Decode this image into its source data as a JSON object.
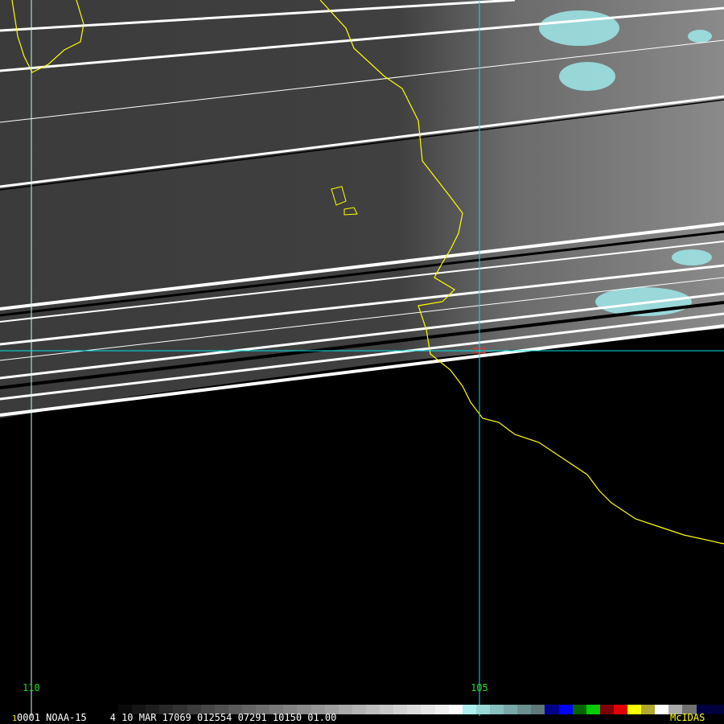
{
  "image": {
    "frame_number": "1",
    "header_text": "0001 NOAA-15    4 10 MAR 17069 012554 07291 10150 01.00",
    "brand": "McIDAS",
    "satellite": "NOAA-15"
  },
  "grid": {
    "longitude_labels": [
      "110",
      "105"
    ]
  },
  "colors": {
    "coastline": "#ffff00",
    "grid_line": "#00e5ee",
    "grid_label": "#22dd22",
    "cloud_tint": "#9fe8ea"
  },
  "colorbar": [
    "#0a0a0a",
    "#141414",
    "#1e1e1e",
    "#282828",
    "#323232",
    "#3c3c3c",
    "#464646",
    "#505050",
    "#5a5a5a",
    "#646464",
    "#6e6e6e",
    "#787878",
    "#828282",
    "#8c8c8c",
    "#969696",
    "#a0a0a0",
    "#aaaaaa",
    "#b4b4b4",
    "#bebebe",
    "#c8c8c8",
    "#d2d2d2",
    "#dcdcdc",
    "#e6e6e6",
    "#f0f0f0",
    "#ffffff",
    "#aeeeee",
    "#9ad8d8",
    "#88c0c0",
    "#78a8a8",
    "#6a9090",
    "#5f7878",
    "#00008b",
    "#0000ff",
    "#006400",
    "#00cc00",
    "#800000",
    "#e00000",
    "#ffff00",
    "#b0a830",
    "#ffffff",
    "#aaaaaa",
    "#707070",
    "#000040",
    "#00003a"
  ]
}
